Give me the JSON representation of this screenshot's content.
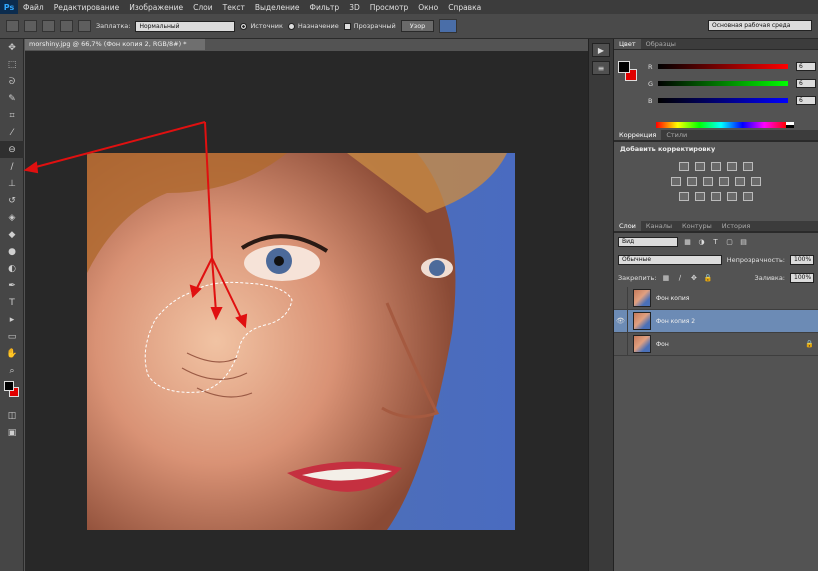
{
  "menubar": {
    "logo": "Ps",
    "items": [
      "Файл",
      "Редактирование",
      "Изображение",
      "Слои",
      "Текст",
      "Выделение",
      "Фильтр",
      "3D",
      "Просмотр",
      "Окно",
      "Справка"
    ]
  },
  "options": {
    "patch_label": "Заплатка:",
    "patch_value": "Нормальный",
    "source_label": "Источник",
    "destination_label": "Назначение",
    "transparent_label": "Прозрачный",
    "pattern_label": "Узор",
    "workspace": "Основная рабочая среда"
  },
  "document": {
    "tab_title": "morshiny.jpg @ 66,7% (Фон копия 2, RGB/8#) *"
  },
  "color_panel": {
    "tabs": [
      "Цвет",
      "Образцы"
    ],
    "fg_color": "#000000",
    "bg_color": "#e10000",
    "sliders": [
      {
        "label": "R",
        "value": "6"
      },
      {
        "label": "G",
        "value": "6"
      },
      {
        "label": "B",
        "value": "6"
      }
    ]
  },
  "adjustments_panel": {
    "tabs": [
      "Коррекция",
      "Стили"
    ],
    "title": "Добавить корректировку"
  },
  "layers_panel": {
    "tabs": [
      "Слои",
      "Каналы",
      "Контуры",
      "История"
    ],
    "kind_label": "Вид",
    "blend_mode": "Обычные",
    "opacity_label": "Непрозрачность:",
    "opacity_value": "100%",
    "lock_label": "Закрепить:",
    "fill_label": "Заливка:",
    "fill_value": "100%",
    "layers": [
      {
        "name": "Фон копия",
        "visible": false,
        "selected": false,
        "locked": false
      },
      {
        "name": "Фон копия 2",
        "visible": true,
        "selected": true,
        "locked": false
      },
      {
        "name": "Фон",
        "visible": false,
        "selected": false,
        "locked": true
      }
    ]
  },
  "colors": {
    "accent_selection": "#6c8bb5",
    "arrow_red": "#e01010"
  }
}
